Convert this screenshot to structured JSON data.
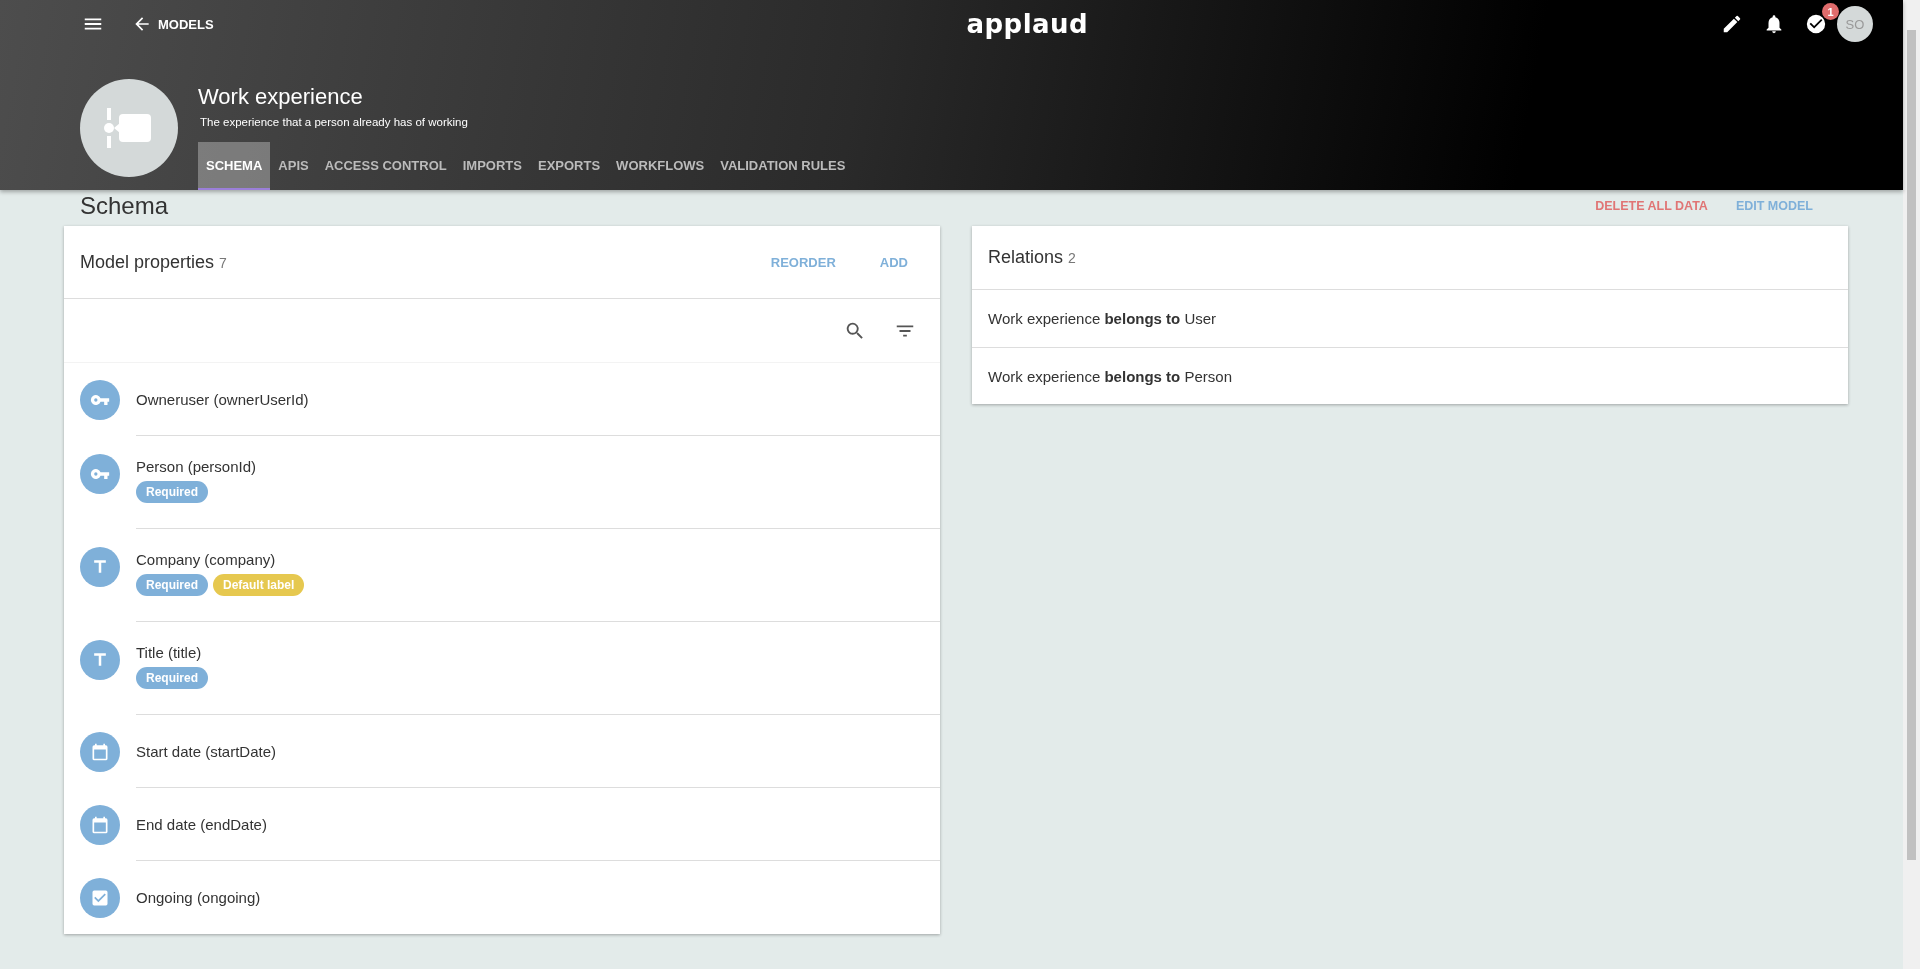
{
  "top_bar": {
    "back_label": "MODELS",
    "logo": "applaud",
    "notifications_badge": "1",
    "avatar_initials": "SO"
  },
  "model": {
    "title": "Work experience",
    "description": "The experience that a person already has of working"
  },
  "tabs": [
    {
      "label": "SCHEMA",
      "selected": true
    },
    {
      "label": "APIS",
      "selected": false
    },
    {
      "label": "ACCESS CONTROL",
      "selected": false
    },
    {
      "label": "IMPORTS",
      "selected": false
    },
    {
      "label": "EXPORTS",
      "selected": false
    },
    {
      "label": "WORKFLOWS",
      "selected": false
    },
    {
      "label": "VALIDATION RULES",
      "selected": false
    }
  ],
  "section": {
    "title": "Schema",
    "delete_action": "DELETE ALL DATA",
    "edit_action": "EDIT MODEL"
  },
  "properties_card": {
    "title": "Model properties",
    "count": "7",
    "actions": [
      "REORDER",
      "ADD"
    ],
    "items": [
      {
        "kind": "key",
        "label": "Owneruser (ownerUserId)"
      },
      {
        "kind": "key",
        "label": "Person (personId)",
        "tags": [
          {
            "label": "Required",
            "color": "#7fb0d9"
          }
        ]
      },
      {
        "kind": "text",
        "label": "Company (company)",
        "tags": [
          {
            "label": "Required",
            "color": "#7fb0d9"
          },
          {
            "label": "Default label",
            "color": "#e6c84f"
          }
        ]
      },
      {
        "kind": "text",
        "label": "Title (title)",
        "tags": [
          {
            "label": "Required",
            "color": "#7fb0d9"
          }
        ]
      },
      {
        "kind": "date",
        "label": "Start date (startDate)"
      },
      {
        "kind": "date",
        "label": "End date (endDate)"
      },
      {
        "kind": "boolean",
        "label": "Ongoing (ongoing)"
      }
    ]
  },
  "relations_card": {
    "title": "Relations",
    "count": "2",
    "items": [
      "Work experience **belongs to** User",
      "Work experience **belongs to** Person"
    ]
  }
}
